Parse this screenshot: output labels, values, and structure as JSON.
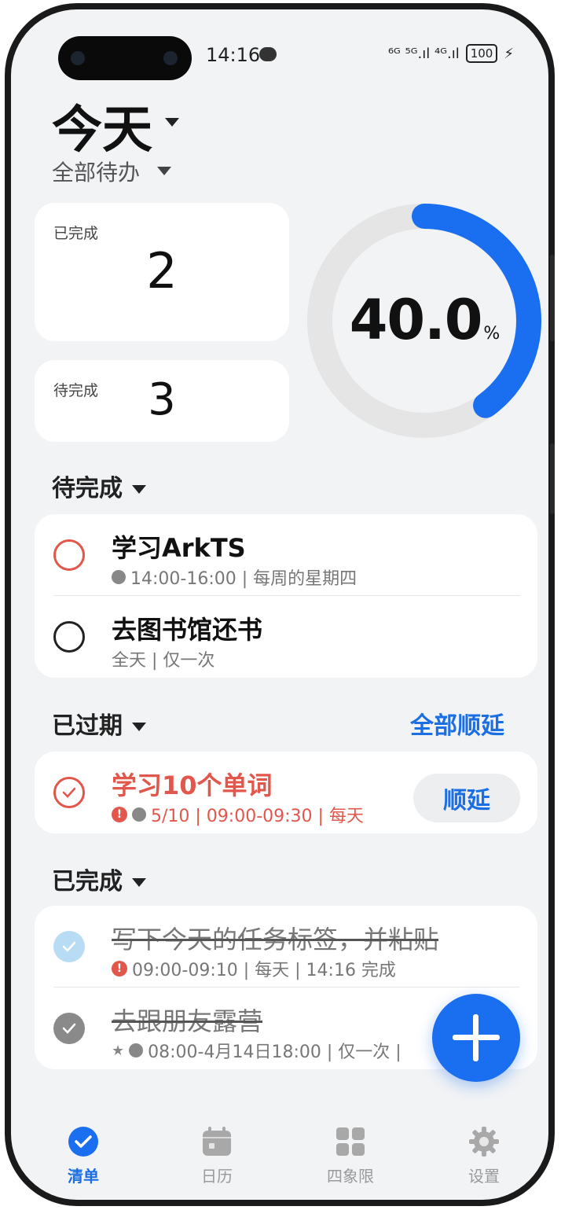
{
  "status_bar": {
    "time": "14:16",
    "signal": "⁶ᴳ ⁵ᴳ.ıl ⁴ᴳ.ıl",
    "battery": "100"
  },
  "header": {
    "title": "今天",
    "filter": "全部待办"
  },
  "stats": {
    "completed_label": "已完成",
    "completed_value": "2",
    "pending_label": "待完成",
    "pending_value": "3",
    "progress_value": "40.0",
    "progress_unit": "%",
    "progress_fraction": 0.4
  },
  "pending": {
    "title": "待完成",
    "tasks": [
      {
        "name": "学习ArkTS",
        "meta": "14:00-16:00 | 每周的星期四"
      },
      {
        "name": "去图书馆还书",
        "meta": "全天 | 仅一次"
      }
    ]
  },
  "overdue": {
    "title": "已过期",
    "action": "全部顺延",
    "tasks": [
      {
        "name": "学习10个单词",
        "meta": "5/10 | 09:00-09:30 | 每天",
        "button": "顺延"
      }
    ]
  },
  "completed": {
    "title": "已完成",
    "tasks": [
      {
        "name": "写下今天的任务标签，并粘贴",
        "meta": "09:00-09:10 | 每天 | 14:16 完成"
      },
      {
        "name": "去跟朋友露营",
        "meta": "08:00-4月14日18:00 | 仅一次 |"
      }
    ]
  },
  "tabs": [
    {
      "label": "清单",
      "icon": "check-circle-icon"
    },
    {
      "label": "日历",
      "icon": "calendar-icon"
    },
    {
      "label": "四象限",
      "icon": "grid-icon"
    },
    {
      "label": "设置",
      "icon": "gear-icon"
    }
  ],
  "colors": {
    "accent": "#1b6fe3",
    "danger": "#e2574c",
    "ring_track": "#e5e5e5"
  }
}
